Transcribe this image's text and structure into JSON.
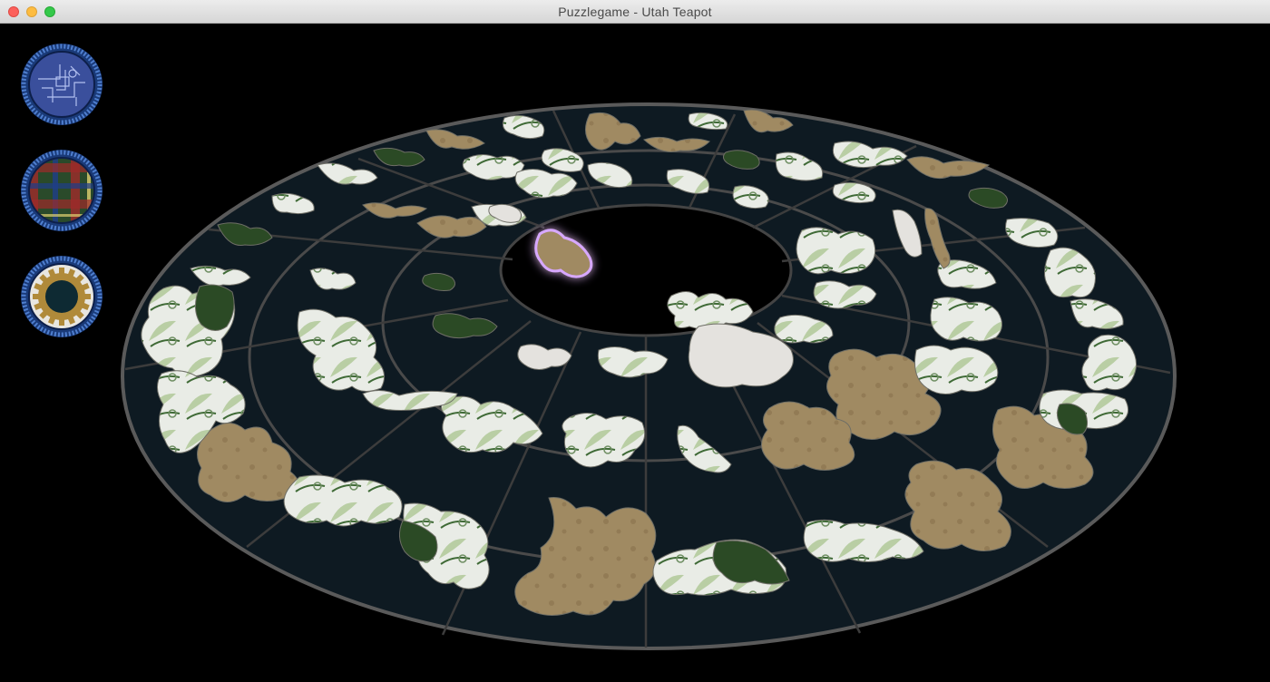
{
  "window": {
    "title": "Puzzlegame - Utah Teapot"
  },
  "toolbar": {
    "buttons": [
      {
        "name": "background-texture-blueprint-button",
        "icon": "blueprint-texture-icon"
      },
      {
        "name": "background-texture-tartan-button",
        "icon": "tartan-texture-icon"
      },
      {
        "name": "settings-gear-button",
        "icon": "gear-icon"
      }
    ]
  },
  "board": {
    "rings": 4,
    "sectors": 20,
    "background_color": "#0e1a22",
    "ring_line_color": "#4a4a4a",
    "hole_color": "#000000",
    "selected_glow_color": "#c77cff"
  },
  "colors": {
    "piece_tan": "#a08a62",
    "piece_white": "#e8e8e4",
    "piece_green": "#2b4a25",
    "piece_light_green": "#b8cfa0"
  }
}
